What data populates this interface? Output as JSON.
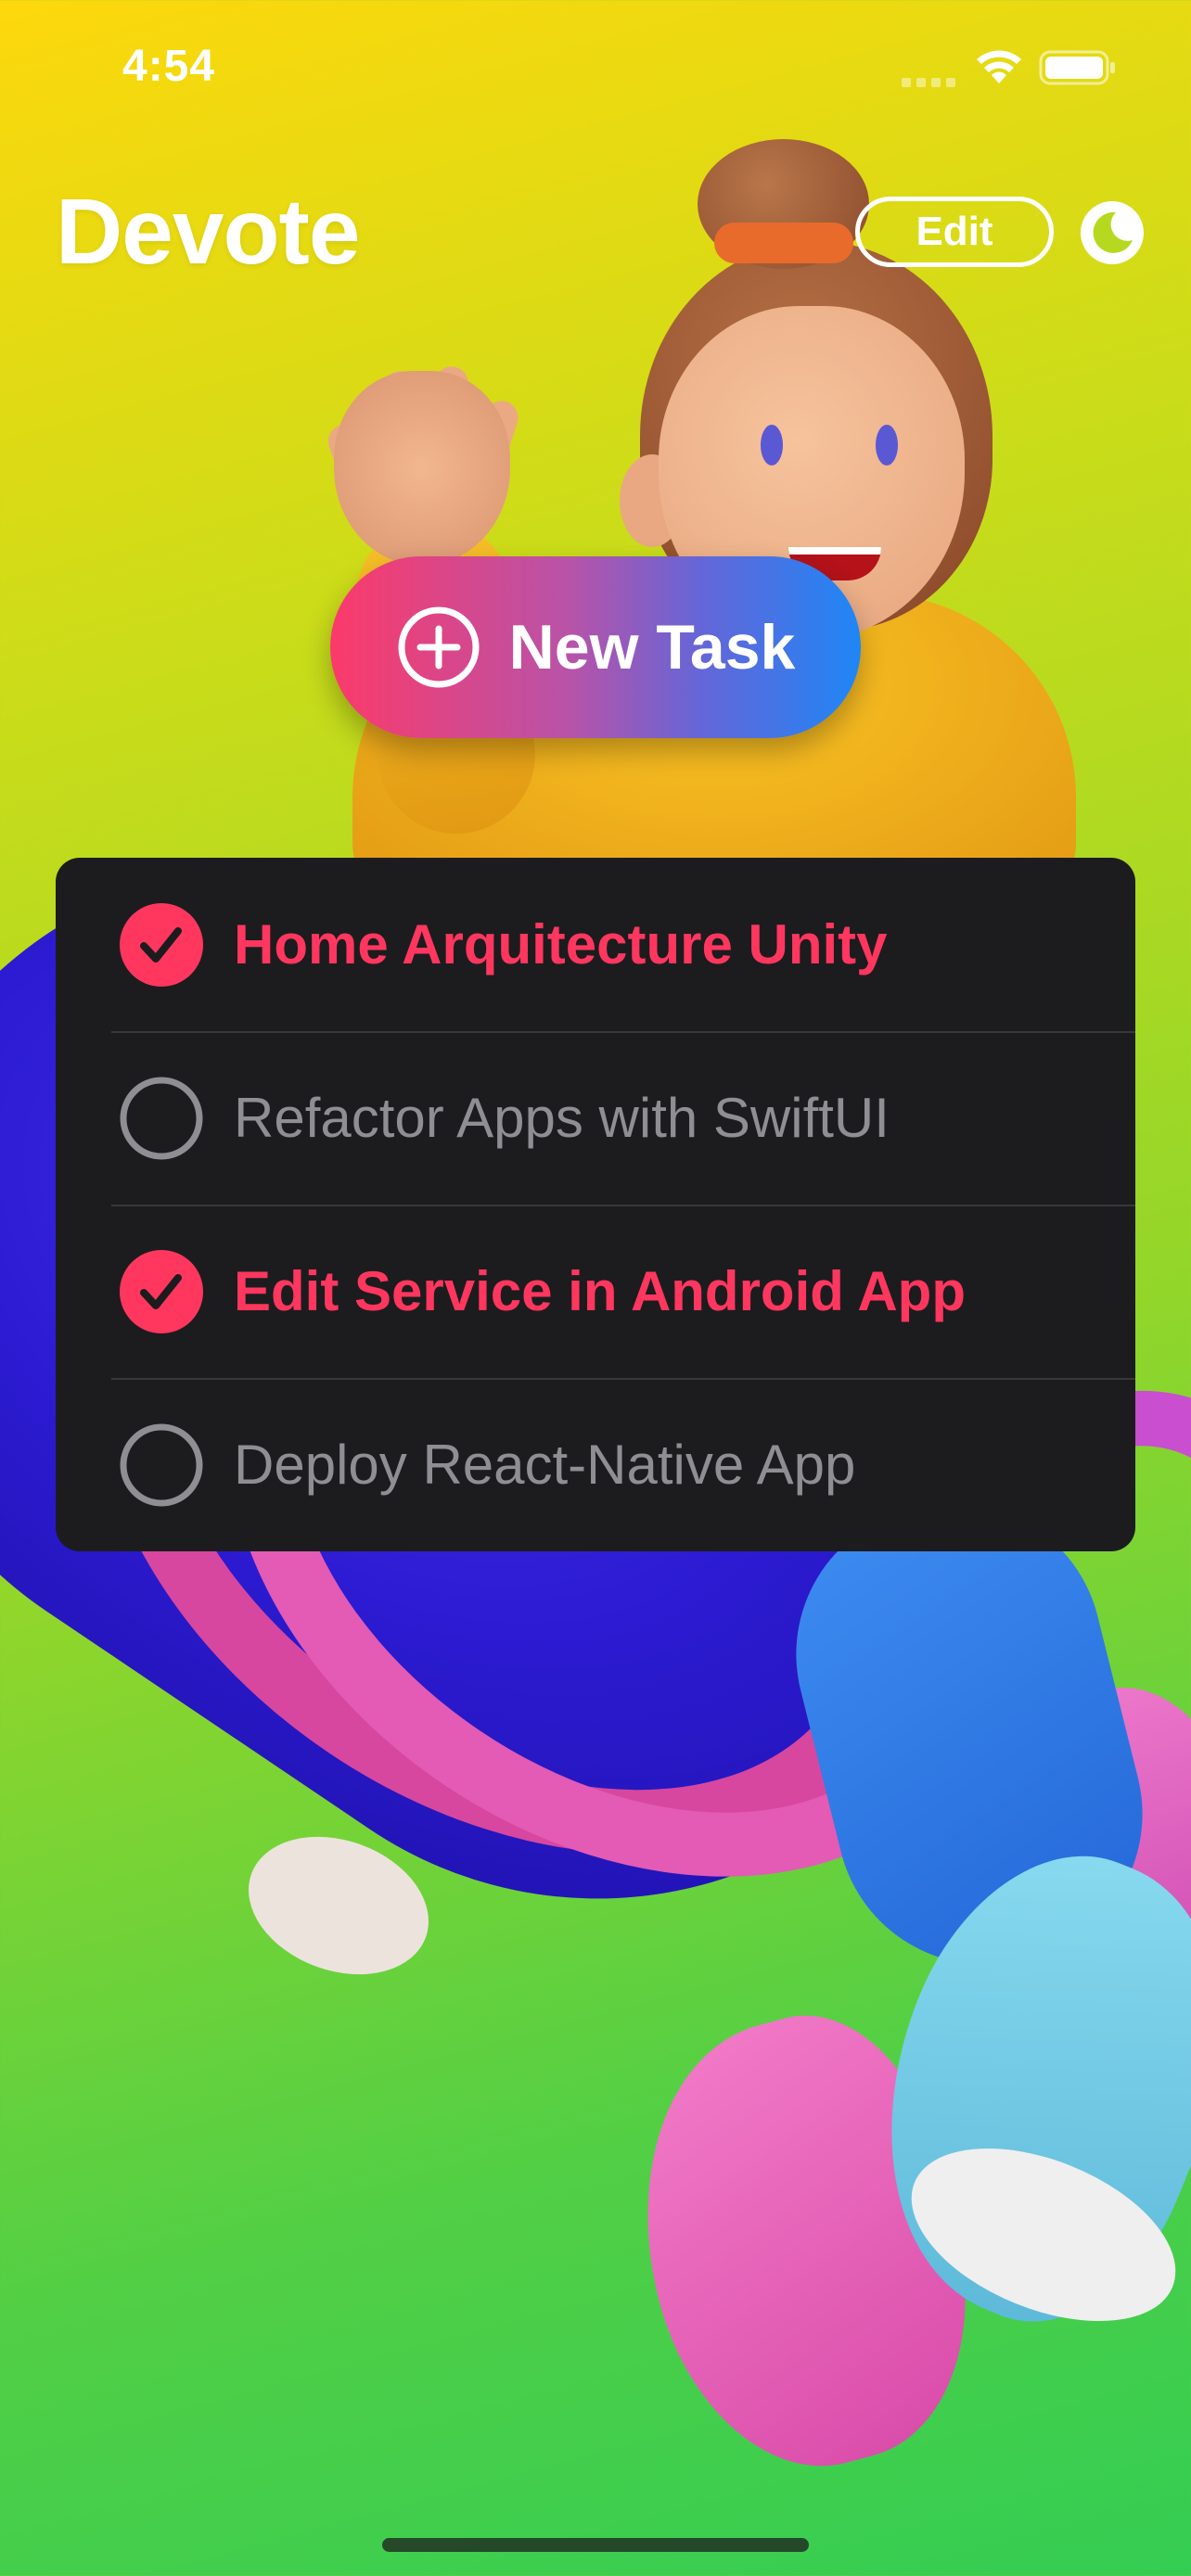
{
  "status_bar": {
    "time": "4:54"
  },
  "header": {
    "title": "Devote",
    "edit_label": "Edit",
    "theme_icon": "moon-icon"
  },
  "new_task": {
    "label": "New Task",
    "icon": "plus-circle-icon"
  },
  "tasks": [
    {
      "title": "Home Arquitecture Unity",
      "completed": true
    },
    {
      "title": "Refactor Apps with SwiftUI",
      "completed": false
    },
    {
      "title": "Edit Service in Android App",
      "completed": true
    },
    {
      "title": "Deploy React-Native App",
      "completed": false
    }
  ],
  "colors": {
    "accent": "#ff375f",
    "list_background": "#1c1c1e",
    "incomplete_text": "#8e8e93",
    "button_gradient_start": "#fb3a6a",
    "button_gradient_end": "#1f86f6"
  }
}
